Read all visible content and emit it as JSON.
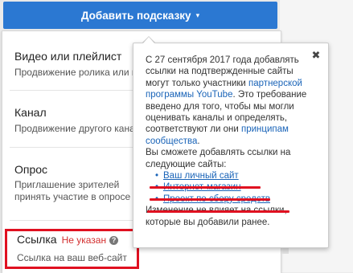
{
  "add_button": {
    "label": "Добавить подсказку",
    "caret": "▾"
  },
  "menu": {
    "items": [
      {
        "title": "Видео или плейлист",
        "desc": "Продвижение ролика или плейлиста"
      },
      {
        "title": "Канал",
        "desc": "Продвижение другого канала"
      },
      {
        "title": "Опрос",
        "desc": "Приглашение зрителей принять участие в опросе"
      }
    ],
    "link_item": {
      "title": "Ссылка",
      "status": "Не указан",
      "help": "?",
      "desc": "Ссылка на ваш веб-сайт"
    }
  },
  "tooltip": {
    "close": "✖",
    "p1_a": "С 27 сентября 2017 года добавлять ссылки на подтвержденные сайты могут только участники ",
    "p1_link1": "партнерской программы YouTube",
    "p1_b": ". Это требование введено для того, чтобы мы могли оценивать каналы и определять, соответствуют ли они ",
    "p1_link2": "принципам сообщества",
    "p1_c": ".",
    "p2": "Вы сможете добавлять ссылки на следующие сайты:",
    "list": [
      "Ваш личный сайт",
      "Интернет-магазин",
      "Проект по сбору средств"
    ],
    "p3": "Изменение не влияет на ссылки, которые вы добавили ранее."
  },
  "colors": {
    "accent": "#2b78d2",
    "link": "#1a64b8",
    "annotation_red": "#e01020",
    "status_red": "#d32f2f"
  }
}
